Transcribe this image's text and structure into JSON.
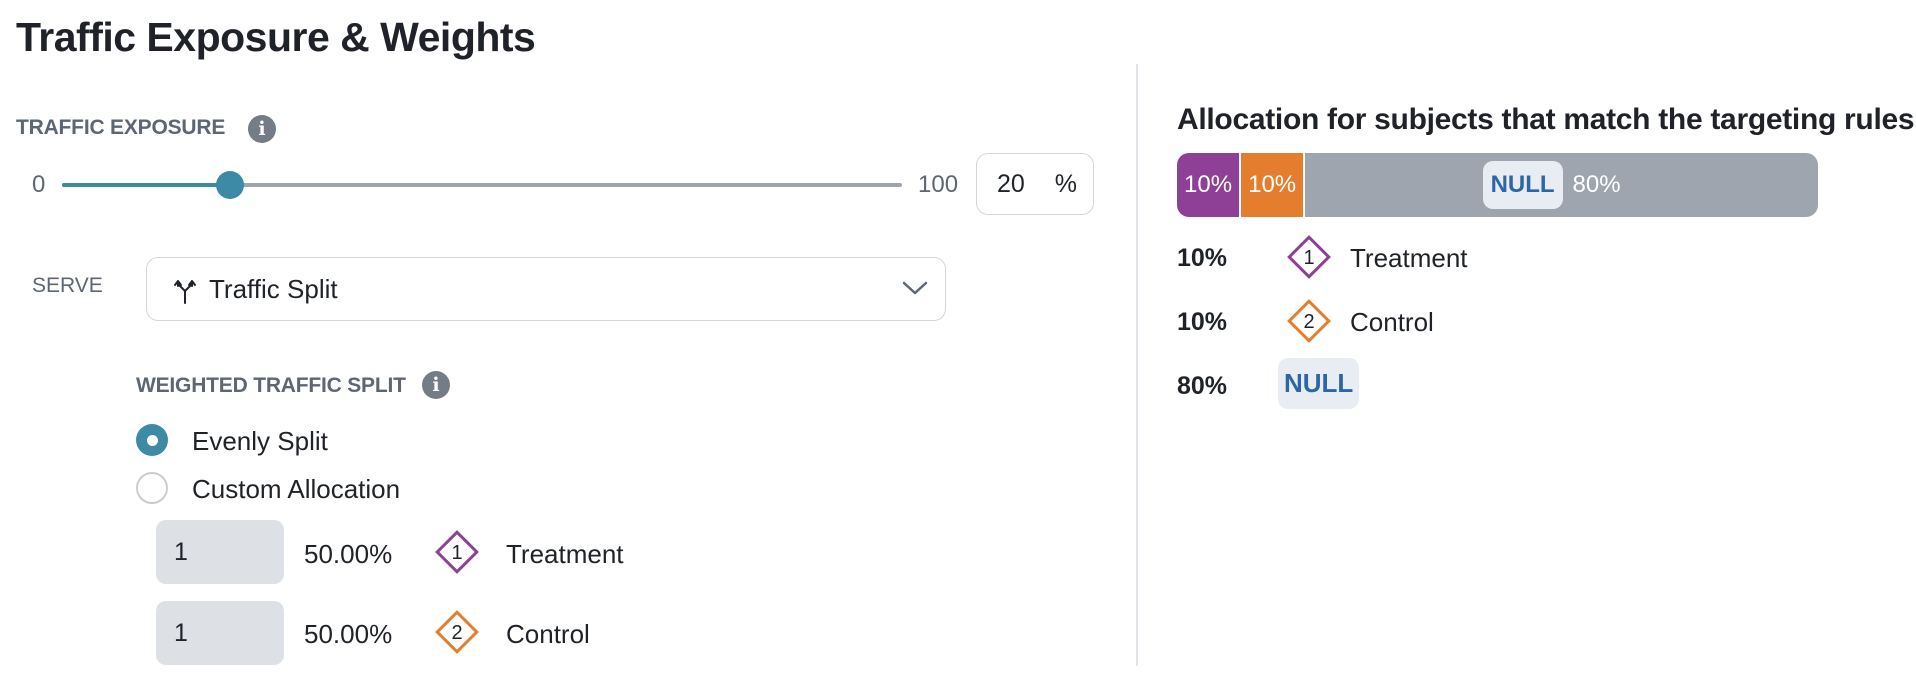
{
  "page_title": "Traffic Exposure & Weights",
  "traffic_exposure": {
    "label": "TRAFFIC EXPOSURE",
    "min_label": "0",
    "max_label": "100",
    "value": "20",
    "unit": "%",
    "slider_fraction": 0.2
  },
  "serve": {
    "label": "SERVE",
    "selected": "Traffic Split",
    "icon": "split-arrows-icon"
  },
  "weighted_split": {
    "label": "WEIGHTED TRAFFIC SPLIT",
    "options": [
      {
        "label": "Evenly Split",
        "selected": true
      },
      {
        "label": "Custom Allocation",
        "selected": false
      }
    ],
    "rows": [
      {
        "weight": "1",
        "percent": "50.00%",
        "badge": "1",
        "name": "Treatment",
        "color": "#8e3f96"
      },
      {
        "weight": "1",
        "percent": "50.00%",
        "badge": "2",
        "name": "Control",
        "color": "#e57d2e"
      }
    ]
  },
  "allocation": {
    "title": "Allocation for subjects that match the targeting rules",
    "bar": [
      {
        "label": "10%",
        "fraction": 0.1,
        "color": "#8e3f96"
      },
      {
        "label": "10%",
        "fraction": 0.1,
        "color": "#e57d2e"
      },
      {
        "null_label": "NULL",
        "label": "80%",
        "fraction": 0.8,
        "color": "#9ea5ae"
      }
    ],
    "legend": [
      {
        "percent": "10%",
        "badge": "1",
        "name": "Treatment",
        "color": "#8e3f96"
      },
      {
        "percent": "10%",
        "badge": "2",
        "name": "Control",
        "color": "#e57d2e"
      },
      {
        "percent": "80%",
        "name": "NULL",
        "color": "#2d66a8"
      }
    ]
  },
  "colors": {
    "accent": "#3d8aa6",
    "treatment": "#8e3f96",
    "control": "#e57d2e",
    "null_text": "#2d66a8",
    "bar_gray": "#9ea5ae"
  }
}
